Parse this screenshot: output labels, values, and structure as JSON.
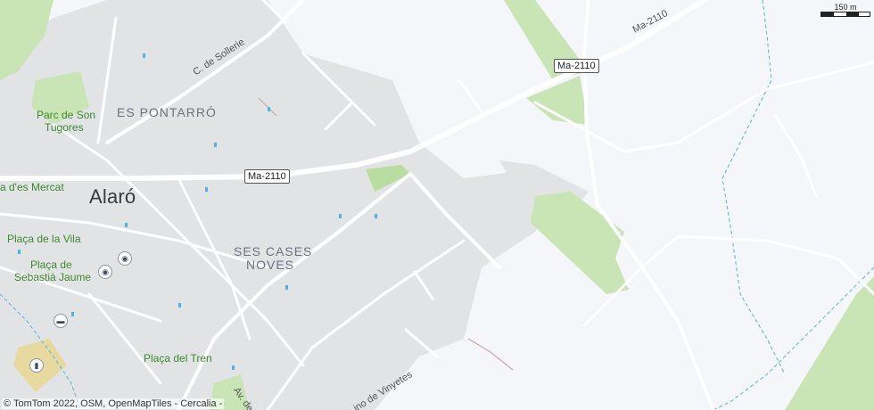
{
  "map": {
    "places": {
      "town": "Alaró"
    },
    "districts": {
      "pontarro": "ES PONTARRÓ",
      "cases_noves_1": "SES CASES",
      "cases_noves_2": "NOVES"
    },
    "parks": {
      "son_tugores_1": "Parc de Son",
      "son_tugores_2": "Tugores"
    },
    "plazas": {
      "mercat": "a d'es Mercat",
      "vila": "Plaça de la Vila",
      "sebastia_1": "Plaça de",
      "sebastia_2": "Sebastià Jaume",
      "tren": "Plaça del Tren"
    },
    "streets": {
      "sollerie": "C. de Sollerie",
      "ma2110_diag": "Ma-2110",
      "vinyetes": "ino de Vinyetes",
      "av": "Av. de"
    },
    "shields": {
      "ma2110_a": "Ma-2110",
      "ma2110_b": "Ma-2110"
    },
    "scale": {
      "label": "150 m"
    },
    "attribution": "© TomTom 2022, OSM, OpenMapTiles - Cercalia -"
  },
  "colors": {
    "background": "#f4f6fa",
    "urban": "#e2e3e5",
    "park": "#c9e5b5",
    "road": "#ffffff",
    "water_line": "#4fb3e8"
  }
}
